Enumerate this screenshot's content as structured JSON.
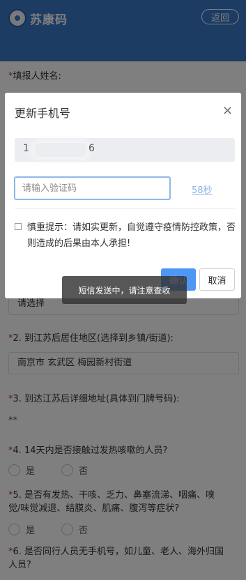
{
  "header": {
    "app_title": "苏康码",
    "back_label": "返回"
  },
  "form": {
    "required_mark": "*",
    "name_label": "填报人姓名:",
    "select_placeholder": "请选择",
    "q2_label": "2. 到江苏后居住地区(选择到乡镇/街道):",
    "q2_value": "南京市 玄武区 梅园新村街道",
    "q3_label": "3. 到达江苏后详细地址(具体到门牌号码):",
    "q3_value": "**",
    "q4_label": "4. 14天内是否接触过发热咳嗽的人员?",
    "q5_label_line1": "5. 是否有发热、干咳、乏力、鼻塞流涕、咽痛、嗅",
    "q5_label_line2": "觉/味觉减退、结膜炎、肌痛、腹泻等症状?",
    "q6_label_line1": "6. 是否同行人员无手机号，如儿童、老人、海外归国",
    "q6_label_line2": "人员?",
    "yes_label": "是",
    "no_label": "否"
  },
  "dialog": {
    "title": "更新手机号",
    "close_symbol": "×",
    "phone_first": "1",
    "phone_last": "6",
    "code_placeholder": "请输入验证码",
    "countdown": "58秒",
    "tip": "慎重提示：请如实更新，自觉遵守疫情防控政策，否则造成的后果由本人承担!",
    "confirm_label": "确认",
    "cancel_label": "取消"
  },
  "toast": {
    "message": "短信发送中，请注意查收"
  },
  "colors": {
    "header_bg": "#3a78c9",
    "required": "#d0312d",
    "primary_button": "#4e98f3",
    "countdown_link": "#8fb3e3"
  }
}
